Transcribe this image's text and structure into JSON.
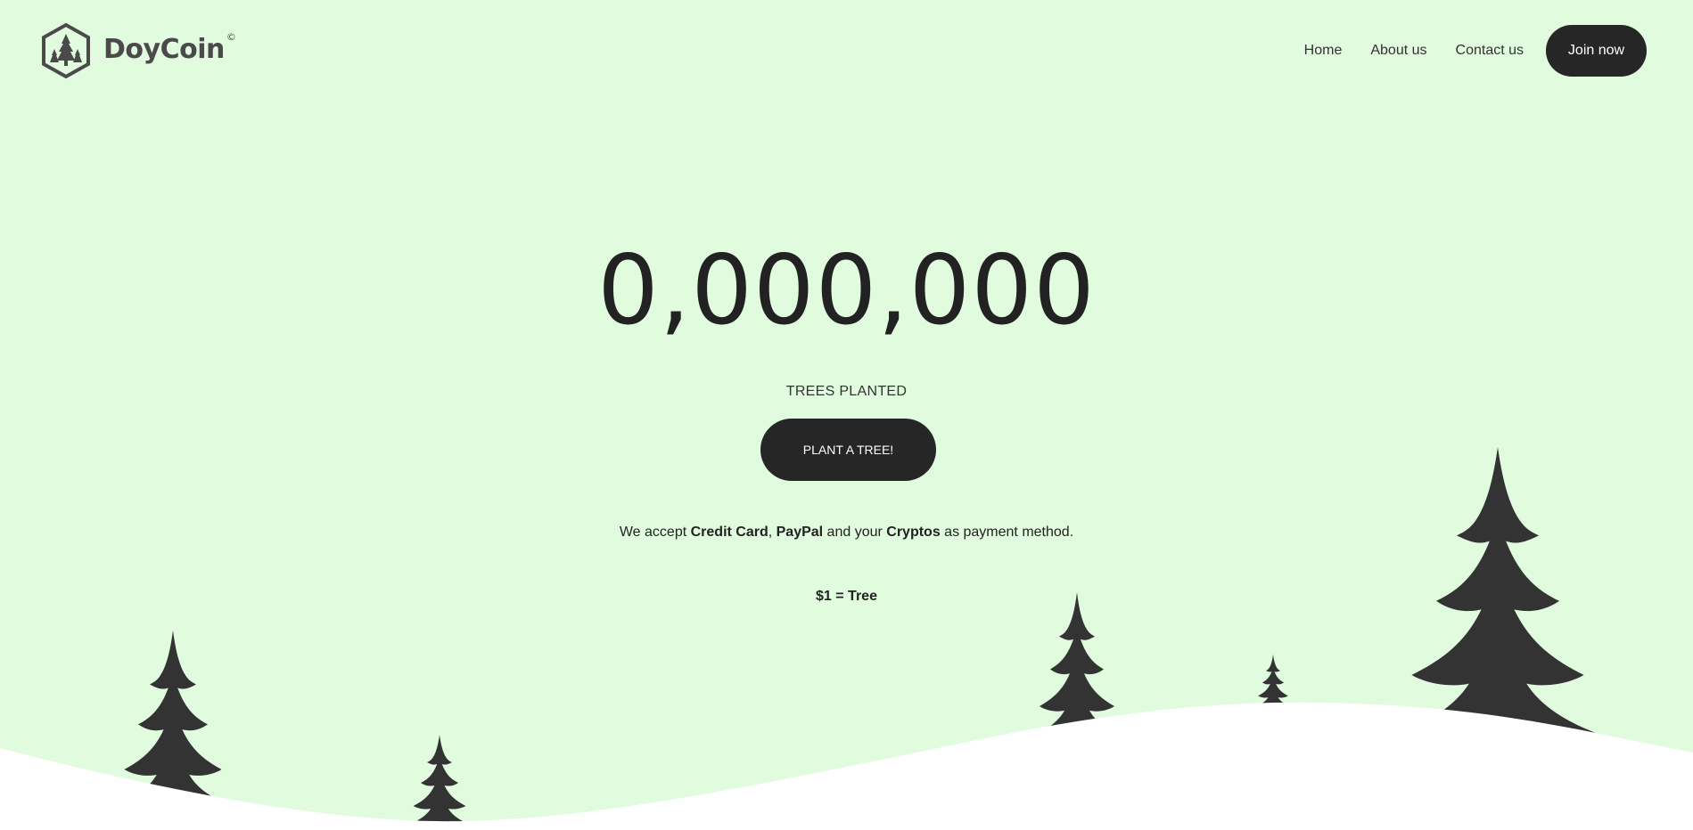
{
  "brand": {
    "name": "DoyCoin",
    "copyright_mark": "©"
  },
  "nav": {
    "items": [
      "Home",
      "About us",
      "Contact us"
    ],
    "cta_label": "Join now"
  },
  "hero": {
    "counter": "0,000,000",
    "counter_label": "TREES PLANTED",
    "cta_label": "PLANT A TREE!"
  },
  "payment": {
    "prefix": "We accept ",
    "method_1": "Credit Card",
    "sep_1": ", ",
    "method_2": "PayPal",
    "sep_2": " and your ",
    "method_3": "Cryptos",
    "suffix": " as payment method."
  },
  "rate": "$1 = Tree",
  "colors": {
    "background": "#e1fbdf",
    "dark": "#262626",
    "tree": "#333333",
    "snow": "#ffffff"
  }
}
